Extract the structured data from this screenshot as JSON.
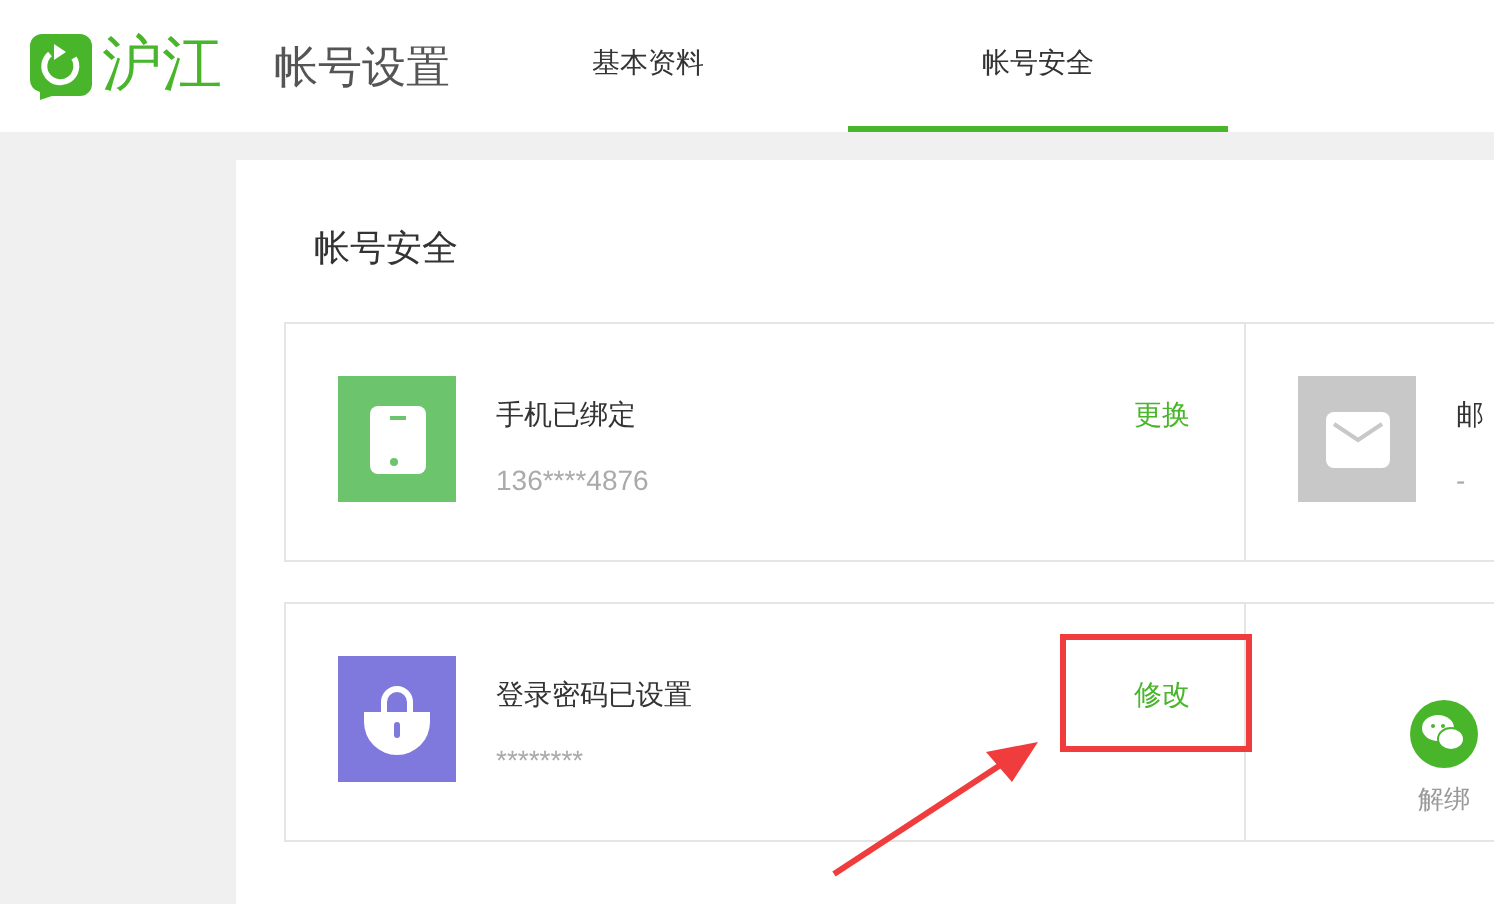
{
  "header": {
    "logo_text": "沪江",
    "title": "帐号设置"
  },
  "tabs": [
    {
      "label": "基本资料",
      "selected": false
    },
    {
      "label": "帐号安全",
      "selected": true
    }
  ],
  "section_title": "帐号安全",
  "cards": [
    {
      "kind": "phone",
      "label": "手机已绑定",
      "value": "136****4876",
      "action": "更换"
    },
    {
      "kind": "email",
      "label": "邮",
      "value": "-"
    },
    {
      "kind": "password",
      "label": "登录密码已设置",
      "value": "********",
      "action": "修改"
    },
    {
      "kind": "wechat",
      "action": "解绑"
    }
  ]
}
